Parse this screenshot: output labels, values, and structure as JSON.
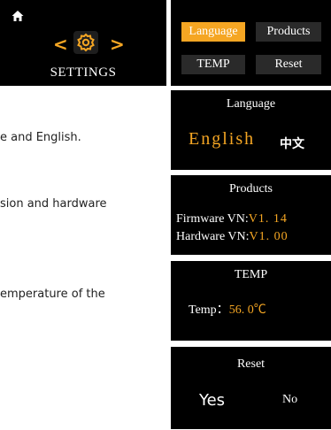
{
  "main_screen": {
    "left_arrow": "<",
    "right_arrow": ">",
    "title": "SETTINGS",
    "home_icon": "home-icon",
    "gear_icon": "gear-icon"
  },
  "menu": {
    "items": [
      "Language",
      "Products",
      "TEMP",
      "Reset"
    ],
    "selected": "Language"
  },
  "descriptions": [
    "e and English.",
    "sion and hardware",
    "emperature of the"
  ],
  "language_screen": {
    "title": "Language",
    "option_english": "English",
    "option_chinese": "中文"
  },
  "products_screen": {
    "title": "Products",
    "firmware_label": "Firmware VN:",
    "firmware_value": "V1. 14",
    "hardware_label": "Hardware VN:",
    "hardware_value": "V1. 00"
  },
  "temp_screen": {
    "title": "TEMP",
    "label": "Temp：",
    "value": "56. 0℃"
  },
  "reset_screen": {
    "title": "Reset",
    "yes": "Yes",
    "no": "No"
  },
  "colors": {
    "accent": "#f5a623",
    "screen_bg": "#000000",
    "button_bg": "#2a2a2a"
  }
}
